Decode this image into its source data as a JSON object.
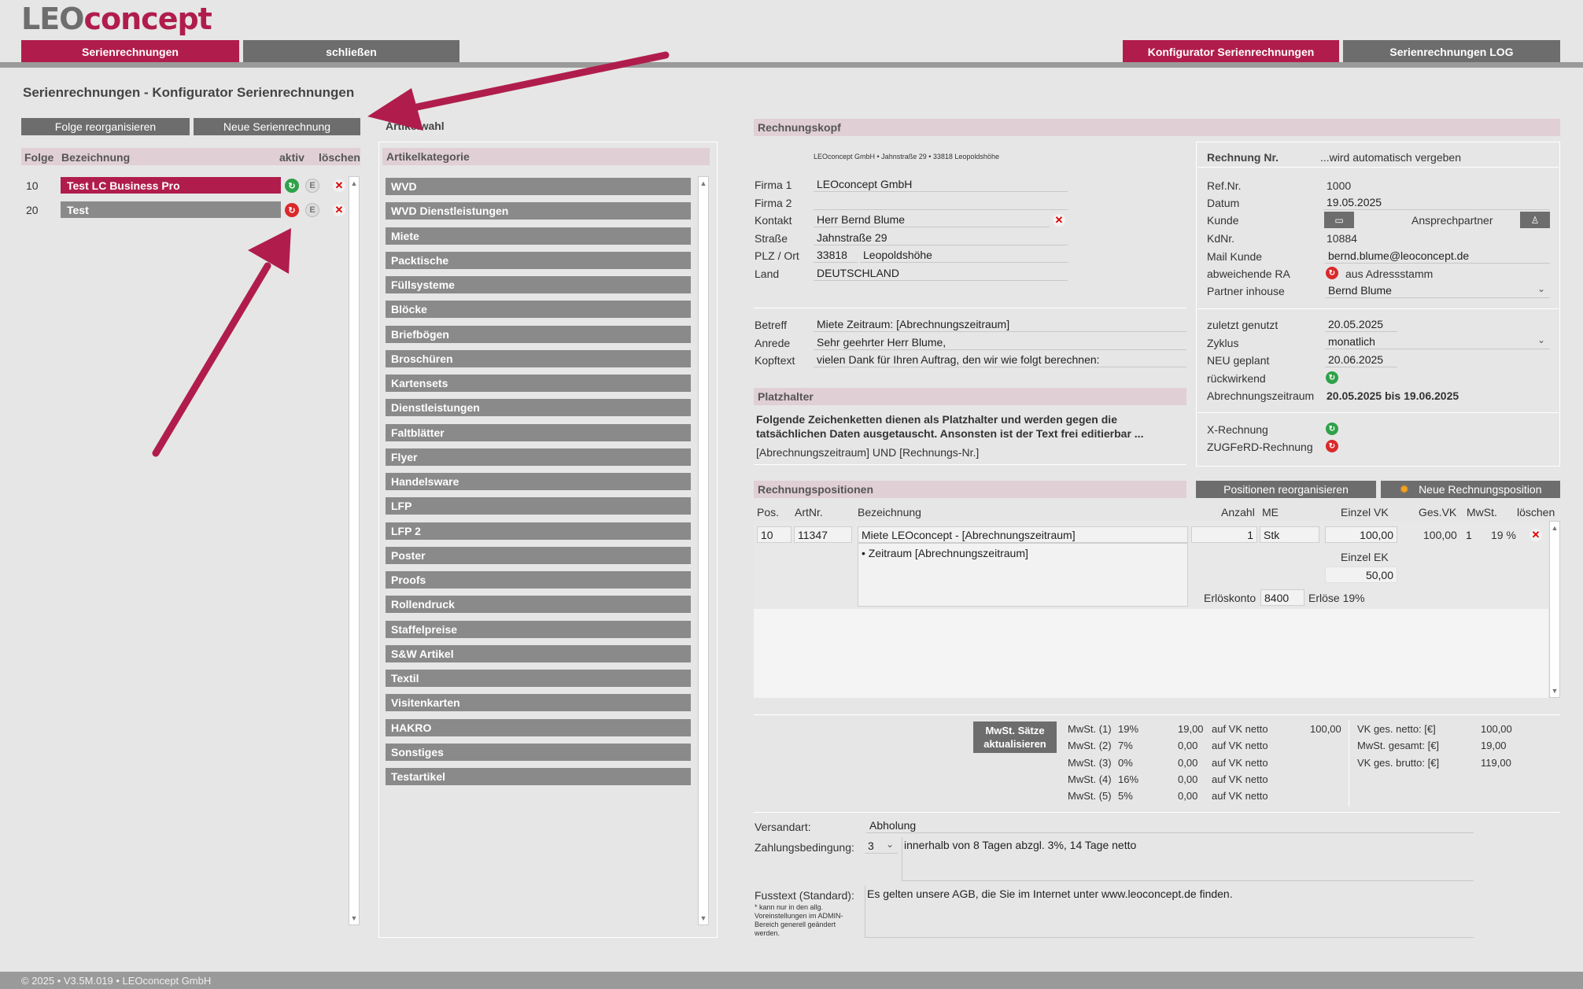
{
  "brand": {
    "part1": "LEO",
    "part2": "concept"
  },
  "topnav": {
    "serien": "Serienrechnungen",
    "schliessen": "schließen",
    "konfigurator": "Konfigurator Serienrechnungen",
    "log": "Serienrechnungen LOG"
  },
  "page_title": "Serienrechnungen - Konfigurator Serienrechnungen",
  "left": {
    "btn_reorg": "Folge reorganisieren",
    "btn_neu": "Neue  Serienrechnung",
    "headers": {
      "folge": "Folge",
      "bezeichnung": "Bezeichnung",
      "aktiv": "aktiv",
      "loeschen": "löschen"
    },
    "rows": [
      {
        "folge": "10",
        "name": "Test LC Business Pro",
        "e": "E"
      },
      {
        "folge": "20",
        "name": "Test",
        "e": "E"
      }
    ]
  },
  "artikel": {
    "title": "Artikelwahl",
    "header": "Artikelkategorie",
    "categories": [
      "WVD",
      "WVD Dienstleistungen",
      "Miete",
      "Packtische",
      "Füllsysteme",
      "Blöcke",
      "Briefbögen",
      "Broschüren",
      "Kartensets",
      "Dienstleistungen",
      "Faltblätter",
      "Flyer",
      "Handelsware",
      "LFP",
      "LFP 2",
      "Poster",
      "Proofs",
      "Rollendruck",
      "Staffelpreise",
      "S&W Artikel",
      "Textil",
      "Visitenkarten",
      "HAKRO",
      "Sonstiges",
      "Testartikel"
    ]
  },
  "rk": {
    "header": "Rechnungskopf",
    "sender": "LEOconcept GmbH • Jahnstraße 29 • 33818 Leopoldshöhe",
    "firma1_label": "Firma 1",
    "firma1": "LEOconcept GmbH",
    "firma2_label": "Firma 2",
    "firma2": "",
    "kontakt_label": "Kontakt",
    "kontakt": "Herr Bernd Blume",
    "strasse_label": "Straße",
    "strasse": "Jahnstraße 29",
    "plzort_label": "PLZ / Ort",
    "plz": "33818",
    "ort": "Leopoldshöhe",
    "land_label": "Land",
    "land": "DEUTSCHLAND",
    "betreff_label": "Betreff",
    "betreff": "Miete Zeitraum: [Abrechnungszeitraum]",
    "anrede_label": "Anrede",
    "anrede": "Sehr geehrter Herr Blume,",
    "kopftext_label": "Kopftext",
    "kopftext": "vielen Dank für Ihren Auftrag, den wir wie folgt berechnen:"
  },
  "platzhalter": {
    "header": "Platzhalter",
    "text": "Folgende Zeichenketten dienen als Platzhalter und werden gegen die tatsächlichen Daten ausgetauscht. Ansonsten ist der Text frei editierbar ...",
    "tokens": "[Abrechnungszeitraum]  UND  [Rechnungs-Nr.]"
  },
  "rinfo": {
    "nr_label": "Rechnung Nr.",
    "nr": "...wird automatisch vergeben",
    "refnr_label": "Ref.Nr.",
    "refnr": "1000",
    "datum_label": "Datum",
    "datum": "19.05.2025",
    "kunde_label": "Kunde",
    "ansprech_label": "Ansprechpartner",
    "kdnr_label": "KdNr.",
    "kdnr": "10884",
    "mail_label": "Mail Kunde",
    "mail": "bernd.blume@leoconcept.de",
    "abw_label": "abweichende RA",
    "abw": "aus Adressstamm",
    "partner_label": "Partner inhouse",
    "partner": "Bernd Blume",
    "zuletzt_label": "zuletzt genutzt",
    "zuletzt": "20.05.2025",
    "zyklus_label": "Zyklus",
    "zyklus": "monatlich",
    "neu_label": "NEU geplant",
    "neu": "20.06.2025",
    "rueck_label": "rückwirkend",
    "zeitraum_label": "Abrechnungszeitraum",
    "zeitraum": "20.05.2025 bis 19.06.2025",
    "xr_label": "X-Rechnung",
    "zug_label": "ZUGFeRD-Rechnung"
  },
  "pos": {
    "header": "Rechnungspositionen",
    "btn_reorg": "Positionen reorganisieren",
    "btn_neu": "Neue Rechnungsposition",
    "cols": {
      "pos": "Pos.",
      "artnr": "ArtNr.",
      "bez": "Bezeichnung",
      "anzahl": "Anzahl",
      "me": "ME",
      "einzel": "Einzel VK",
      "ges": "Ges.VK",
      "mwst": "MwSt.",
      "loeschen": "löschen"
    },
    "row": {
      "pos": "10",
      "artnr": "11347",
      "bez": "Miete LEOconcept - [Abrechnungszeitraum]",
      "detail": "• Zeitraum [Abrechnungszeitraum]",
      "anzahl": "1",
      "me": "Stk",
      "einzel": "100,00",
      "ges": "100,00",
      "mwst_code": "1",
      "mwst_pct": "19 %",
      "ek_label": "Einzel EK",
      "ek": "50,00",
      "erl_label": "Erlöskonto",
      "erl_nr": "8400",
      "erl_text": "Erlöse 19%"
    }
  },
  "mwst": {
    "btn": "MwSt. Sätze aktualisieren",
    "rows": [
      {
        "label": "MwSt. (1)",
        "pct": "19%",
        "betrag": "19,00",
        "basis": "auf VK netto",
        "netto": "100,00"
      },
      {
        "label": "MwSt. (2)",
        "pct": "7%",
        "betrag": "0,00",
        "basis": "auf VK netto",
        "netto": ""
      },
      {
        "label": "MwSt. (3)",
        "pct": "0%",
        "betrag": "0,00",
        "basis": "auf VK netto",
        "netto": ""
      },
      {
        "label": "MwSt. (4)",
        "pct": "16%",
        "betrag": "0,00",
        "basis": "auf VK netto",
        "netto": ""
      },
      {
        "label": "MwSt. (5)",
        "pct": "5%",
        "betrag": "0,00",
        "basis": "auf VK netto",
        "netto": ""
      }
    ],
    "sum": [
      {
        "label": "VK ges. netto: [€]",
        "value": "100,00"
      },
      {
        "label": "MwSt. gesamt: [€]",
        "value": "19,00"
      },
      {
        "label": "VK ges. brutto: [€]",
        "value": "119,00"
      }
    ]
  },
  "bottom": {
    "versand_label": "Versandart:",
    "versand": "Abholung",
    "zahlung_label": "Zahlungsbedingung:",
    "zahlung_code": "3",
    "zahlung": "innerhalb von 8 Tagen abzgl. 3%, 14 Tage netto",
    "fuss_label": "Fusstext (Standard):",
    "fuss_note": "* kann nur in den allg. Voreinstellungen im ADMIN-Bereich generell geändert werden.",
    "fuss": "Es gelten unsere AGB, die Sie im Internet unter www.leoconcept.de finden."
  },
  "footer": "© 2025 • V3.5M.019 • LEOconcept GmbH",
  "colors": {
    "accent": "#b01d4c",
    "button_grey": "#6d6d6d",
    "active_green": "#2fa14a",
    "inactive_red": "#d9292b"
  }
}
